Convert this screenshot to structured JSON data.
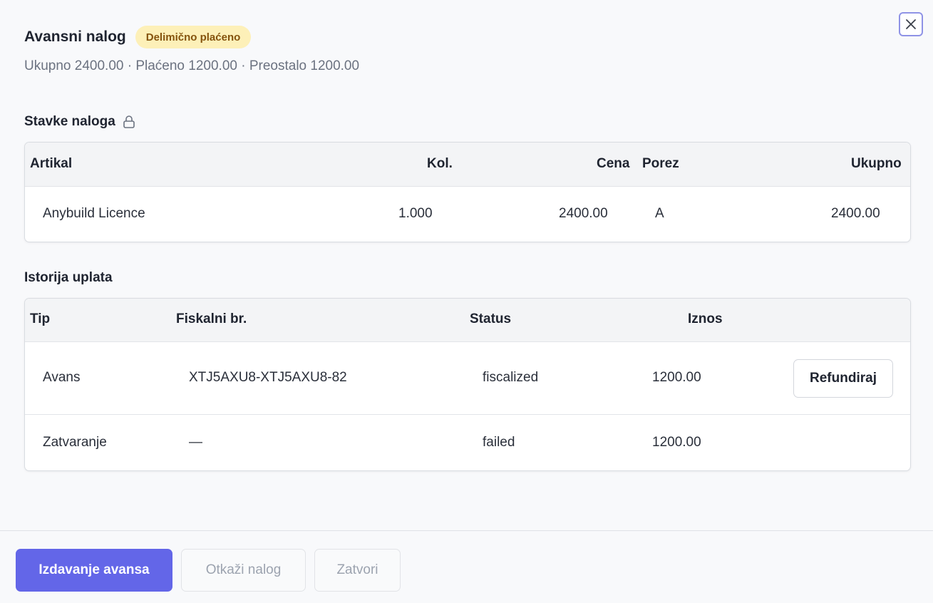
{
  "header": {
    "title": "Avansni nalog",
    "status_badge": "Delimično plaćeno",
    "summary": "Ukupno 2400.00 · Plaćeno 1200.00 · Preostalo 1200.00",
    "close_icon": "close-icon"
  },
  "items_section": {
    "title": "Stavke naloga",
    "icon": "lock-icon",
    "columns": {
      "article": "Artikal",
      "qty": "Kol.",
      "price": "Cena",
      "tax": "Porez",
      "total": "Ukupno"
    },
    "rows": [
      {
        "article": "Anybuild Licence",
        "qty": "1.000",
        "price": "2400.00",
        "tax": "A",
        "total": "2400.00"
      }
    ]
  },
  "payments_section": {
    "title": "Istorija uplata",
    "columns": {
      "type": "Tip",
      "fiscal_no": "Fiskalni br.",
      "status": "Status",
      "amount": "Iznos"
    },
    "rows": [
      {
        "type": "Avans",
        "fiscal_no": "XTJ5AXU8-XTJ5AXU8-82",
        "status": "fiscalized",
        "amount": "1200.00",
        "action": "Refundiraj"
      },
      {
        "type": "Zatvaranje",
        "fiscal_no": "—",
        "status": "failed",
        "amount": "1200.00"
      }
    ]
  },
  "footer": {
    "primary_label": "Izdavanje avansa",
    "cancel_label": "Otkaži nalog",
    "close_label": "Zatvori"
  },
  "colors": {
    "accent": "#6366e8",
    "badge_bg": "#fdf0b8",
    "badge_text": "#85530d"
  }
}
